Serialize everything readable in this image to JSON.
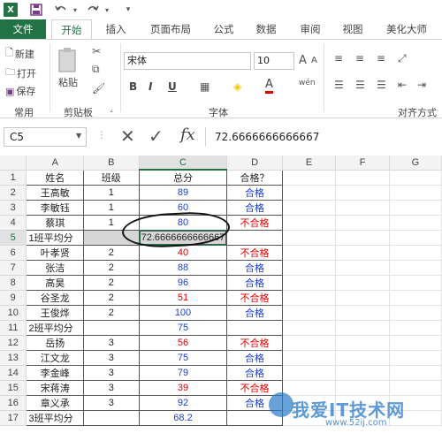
{
  "title_bar": {
    "logo": "X",
    "undo_dd": "▾",
    "redo_dd": "▾",
    "qat_dd": "▾"
  },
  "tabs": [
    "文件",
    "开始",
    "插入",
    "页面布局",
    "公式",
    "数据",
    "审阅",
    "视图",
    "美化大师"
  ],
  "ribbon": {
    "new": "新建",
    "open": "打开",
    "save": "保存",
    "group_common": "常用",
    "paste": "粘贴",
    "group_clipboard": "剪贴板",
    "font_name": "宋体",
    "font_size": "10",
    "grow": "A",
    "shrink": "A",
    "bold": "B",
    "italic": "I",
    "underline": "U",
    "wen": "wén",
    "group_font": "字体",
    "group_align": "对齐方式"
  },
  "formula_bar": {
    "name_box": "C5",
    "fx": "fx",
    "formula": "72.6666666666667"
  },
  "columns": [
    "A",
    "B",
    "C",
    "D",
    "E",
    "F",
    "G"
  ],
  "rows": [
    {
      "n": "1",
      "a": "姓名",
      "b": "班级",
      "c": "总分",
      "d": "合格？",
      "cc": "",
      "dc": ""
    },
    {
      "n": "2",
      "a": "王高敏",
      "b": "1",
      "c": "89",
      "d": "合格",
      "cc": "c-blue",
      "dc": "c-blue"
    },
    {
      "n": "3",
      "a": "李敏钰",
      "b": "1",
      "c": "60",
      "d": "合格",
      "cc": "c-blue",
      "dc": "c-blue"
    },
    {
      "n": "4",
      "a": "蔡琪",
      "b": "1",
      "c": "80",
      "d": "不合格",
      "cc": "c-blue",
      "dc": "c-red"
    },
    {
      "n": "5",
      "a": "1班平均分",
      "b": "",
      "c": "72.6666666666667",
      "d": "",
      "cc": "",
      "dc": ""
    },
    {
      "n": "6",
      "a": "叶孝贤",
      "b": "2",
      "c": "40",
      "d": "不合格",
      "cc": "c-red",
      "dc": "c-red"
    },
    {
      "n": "7",
      "a": "张洁",
      "b": "2",
      "c": "88",
      "d": "合格",
      "cc": "c-blue",
      "dc": "c-blue"
    },
    {
      "n": "8",
      "a": "高昊",
      "b": "2",
      "c": "96",
      "d": "合格",
      "cc": "c-blue",
      "dc": "c-blue"
    },
    {
      "n": "9",
      "a": "谷圣龙",
      "b": "2",
      "c": "51",
      "d": "不合格",
      "cc": "c-red",
      "dc": "c-red"
    },
    {
      "n": "10",
      "a": "王俊烨",
      "b": "2",
      "c": "100",
      "d": "合格",
      "cc": "c-blue",
      "dc": "c-blue"
    },
    {
      "n": "11",
      "a": "2班平均分",
      "b": "",
      "c": "75",
      "d": "",
      "cc": "c-blue",
      "dc": ""
    },
    {
      "n": "12",
      "a": "岳扬",
      "b": "3",
      "c": "56",
      "d": "不合格",
      "cc": "c-red",
      "dc": "c-red"
    },
    {
      "n": "13",
      "a": "江文龙",
      "b": "3",
      "c": "75",
      "d": "合格",
      "cc": "c-blue",
      "dc": "c-blue"
    },
    {
      "n": "14",
      "a": "李金峰",
      "b": "3",
      "c": "79",
      "d": "合格",
      "cc": "c-blue",
      "dc": "c-blue"
    },
    {
      "n": "15",
      "a": "宋蒋涛",
      "b": "3",
      "c": "39",
      "d": "不合格",
      "cc": "c-red",
      "dc": "c-red"
    },
    {
      "n": "16",
      "a": "章义承",
      "b": "3",
      "c": "92",
      "d": "合格",
      "cc": "c-blue",
      "dc": "c-blue"
    },
    {
      "n": "17",
      "a": "3班平均分",
      "b": "",
      "c": "68.2",
      "d": "",
      "cc": "c-blue",
      "dc": ""
    }
  ],
  "watermark": {
    "main": "我爱IT技术网",
    "sub": "www.52ij.com"
  },
  "colors": {
    "excel_green": "#217346",
    "pass_blue": "#1a3bd6",
    "fail_red": "#e00000"
  }
}
